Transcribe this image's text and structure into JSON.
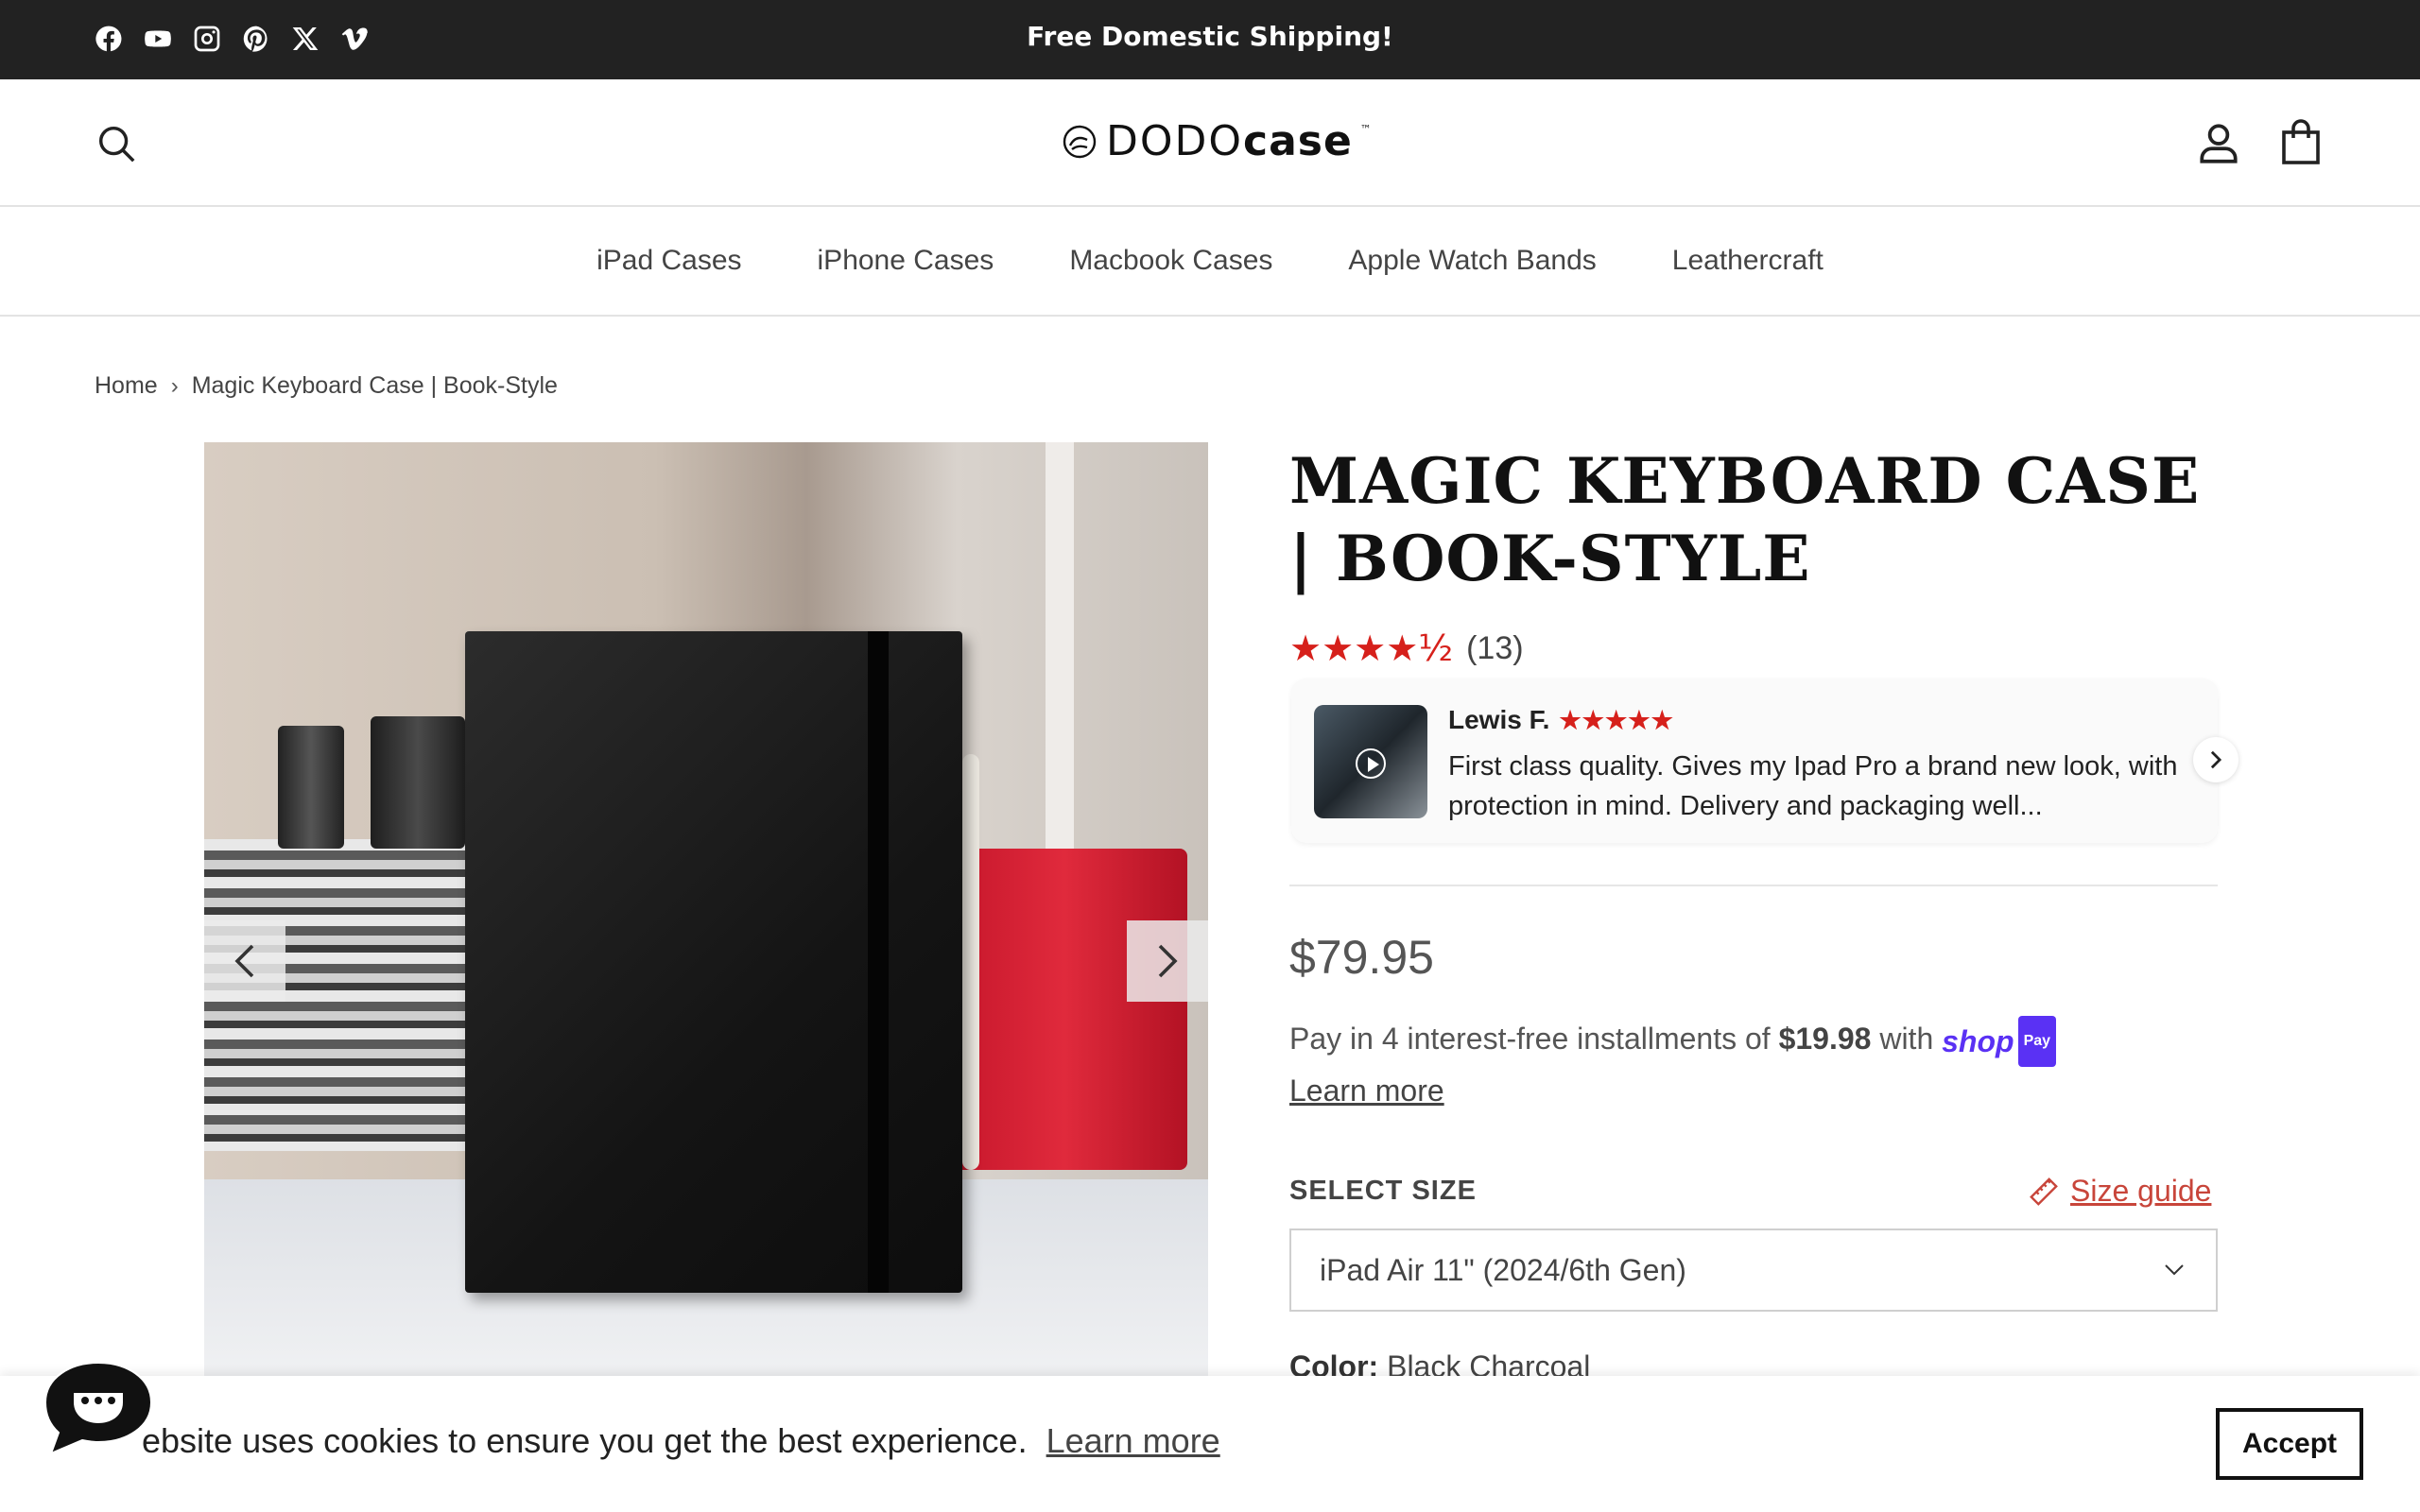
{
  "announcement": {
    "text": "Free Domestic Shipping!"
  },
  "social": [
    "facebook-icon",
    "youtube-icon",
    "instagram-icon",
    "pinterest-icon",
    "x-icon",
    "vimeo-icon"
  ],
  "logo": {
    "light": "DODO",
    "bold": "case",
    "tm": "™"
  },
  "nav": [
    {
      "label": "iPad Cases"
    },
    {
      "label": "iPhone Cases"
    },
    {
      "label": "Macbook Cases"
    },
    {
      "label": "Apple Watch Bands"
    },
    {
      "label": "Leathercraft"
    }
  ],
  "breadcrumb": {
    "home": "Home",
    "sep": "›",
    "current": "Magic Keyboard Case | Book-Style"
  },
  "product": {
    "title": "MAGIC KEYBOARD CASE | BOOK-STYLE",
    "rating_stars": "★★★★½",
    "rating_value": 4.5,
    "review_count": "(13)",
    "price": "$79.95",
    "installments_prefix": "Pay in 4 interest-free installments of",
    "installments_amount": "$19.98",
    "installments_with": "with",
    "shoppay_word": "shop",
    "shoppay_badge": "Pay",
    "learn_more": "Learn more",
    "size_label": "SELECT SIZE",
    "size_guide": "Size guide",
    "size_selected": "iPad Air 11\" (2024/6th Gen)",
    "color_label": "Color:",
    "color_value": "Black Charcoal"
  },
  "review": {
    "name": "Lewis F.",
    "stars": "★★★★★",
    "text": "First class quality. Gives my Ipad Pro a brand new look, with protection in mind. Delivery and packaging well..."
  },
  "cookie": {
    "text": "ebsite uses cookies to ensure you get the best experience.",
    "learn_more": "Learn more",
    "accept": "Accept"
  },
  "colors": {
    "topbar": "#222222",
    "star": "#d6201b",
    "shoppay": "#5a31f4",
    "size_guide": "#c8453a"
  }
}
